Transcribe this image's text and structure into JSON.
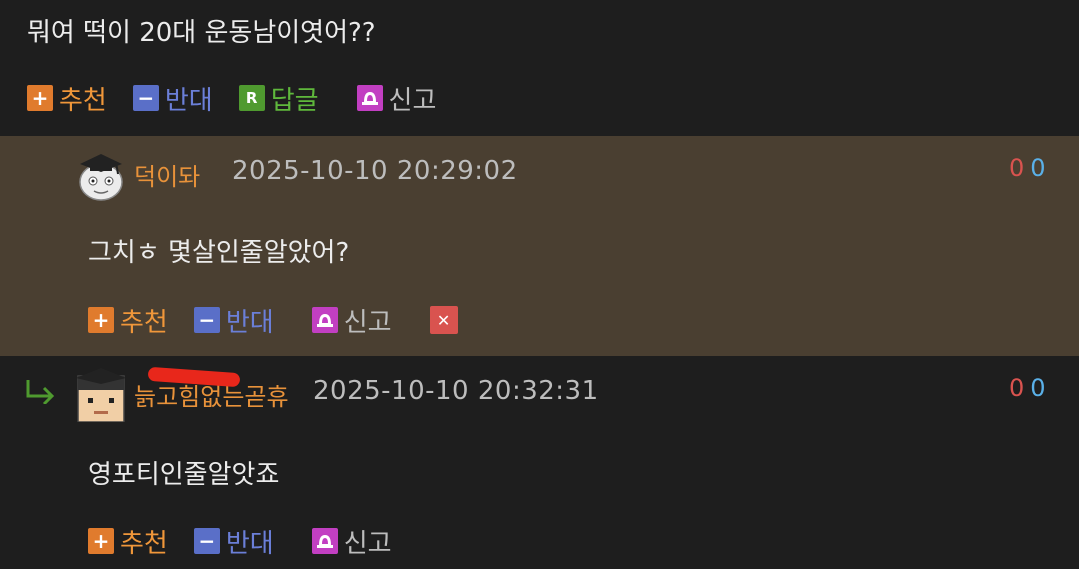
{
  "top_comment": {
    "text": "뭐여 떡이 20대 운동남이엿어??",
    "actions": {
      "recommend": "추천",
      "oppose": "반대",
      "reply": "답글",
      "report": "신고"
    },
    "icons": {
      "plus": "+",
      "minus": "−",
      "reply": "R"
    }
  },
  "reply1": {
    "nickname": "덕이돠",
    "date": "2025-10-10 20:29:02",
    "votes_up": "0",
    "votes_down": "0",
    "text": "그치ㅎ 몇살인줄알았어?",
    "actions": {
      "recommend": "추천",
      "oppose": "반대",
      "report": "신고"
    },
    "icons": {
      "plus": "+",
      "minus": "−",
      "delete": "✕"
    }
  },
  "reply2": {
    "nickname": "늙고힘없는곧휴",
    "date": "2025-10-10 20:32:31",
    "votes_up": "0",
    "votes_down": "0",
    "text": "영포티인줄알앗죠",
    "actions": {
      "recommend": "추천",
      "oppose": "반대",
      "report": "신고"
    },
    "icons": {
      "plus": "+",
      "minus": "−"
    }
  },
  "colors": {
    "background": "#1e1e1e",
    "highlight_row": "#4a3f31",
    "recommend": "#e07b2d",
    "oppose": "#5a6fc8",
    "reply": "#4f9a2f",
    "report": "#c23fc2",
    "nickname": "#e8923a",
    "vote_up": "#d9534f",
    "vote_down": "#5ab0e8"
  }
}
